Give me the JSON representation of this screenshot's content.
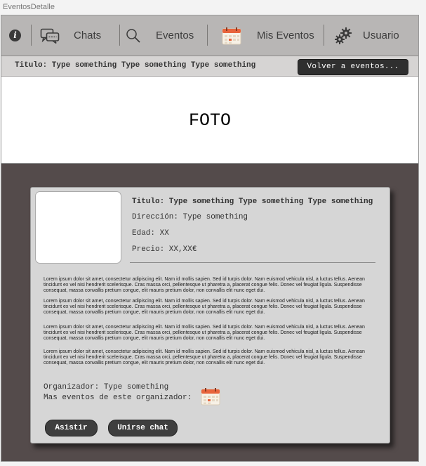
{
  "window_title": "EventosDetalle",
  "nav": {
    "info_icon_glyph": "i",
    "items": [
      {
        "label": "Chats",
        "icon": "chat-bubbles-icon"
      },
      {
        "label": "Eventos",
        "icon": "search-icon"
      },
      {
        "label": "Mis Eventos",
        "icon": "calendar-icon"
      },
      {
        "label": "Usuario",
        "icon": "gears-icon"
      }
    ]
  },
  "header": {
    "title": "Titulo: Type something Type something Type something",
    "back_button": "Volver a eventos..."
  },
  "photo_label": "FOTO",
  "details": {
    "title": "Titulo: Type something Type something Type something",
    "address": "Dirección: Type something",
    "age": "Edad: XX",
    "price": "Precio: XX,XX€"
  },
  "description": [
    "Lorem ipsum dolor sit amet, consectetur adipiscing elit. Nam id mollis sapien. Sed id turpis dolor. Nam euismod vehicula nisl, a luctus tellus. Aenean tincidunt ex vel nisi hendrerit scelerisque. Cras massa orci, pellentesque ut pharetra a, placerat congue felis. Donec vel feugiat ligula. Suspendisse consequat, massa convallis pretium congue, elit mauris pretium dolor, non convallis elit nunc eget dui.",
    "Lorem ipsum dolor sit amet, consectetur adipiscing elit. Nam id mollis sapien. Sed id turpis dolor. Nam euismod vehicula nisl, a luctus tellus. Aenean tincidunt ex vel nisi hendrerit scelerisque. Cras massa orci, pellentesque ut pharetra a, placerat congue felis. Donec vel feugiat ligula. Suspendisse consequat, massa convallis pretium congue, elit mauris pretium dolor, non convallis elit nunc eget dui.",
    "Lorem ipsum dolor sit amet, consectetur adipiscing elit. Nam id mollis sapien. Sed id turpis dolor. Nam euismod vehicula nisl, a luctus tellus. Aenean tincidunt ex vel nisi hendrerit scelerisque. Cras massa orci, pellentesque ut pharetra a, placerat congue felis. Donec vel feugiat ligula. Suspendisse consequat, massa convallis pretium congue, elit mauris pretium dolor, non convallis elit nunc eget dui.",
    "Lorem ipsum dolor sit amet, consectetur adipiscing elit. Nam id mollis sapien. Sed id turpis dolor. Nam euismod vehicula nisl, a luctus tellus. Aenean tincidunt ex vel nisi hendrerit scelerisque. Cras massa orci, pellentesque ut pharetra a, placerat congue felis. Donec vel feugiat ligula. Suspendisse consequat, massa convallis pretium congue, elit mauris pretium dolor, non convallis elit nunc eget dui."
  ],
  "organizer": {
    "label": "Organizador: Type something",
    "more_events": "Mas eventos de este organizador:"
  },
  "actions": {
    "attend": "Asistir",
    "join_chat": "Unirse chat"
  },
  "colors": {
    "nav_bg": "#b8b6b5",
    "body_bg": "#544b4b",
    "card_bg": "#d6d6d6",
    "button_dark": "#3e3e3e",
    "calendar_accent": "#e8643c"
  }
}
